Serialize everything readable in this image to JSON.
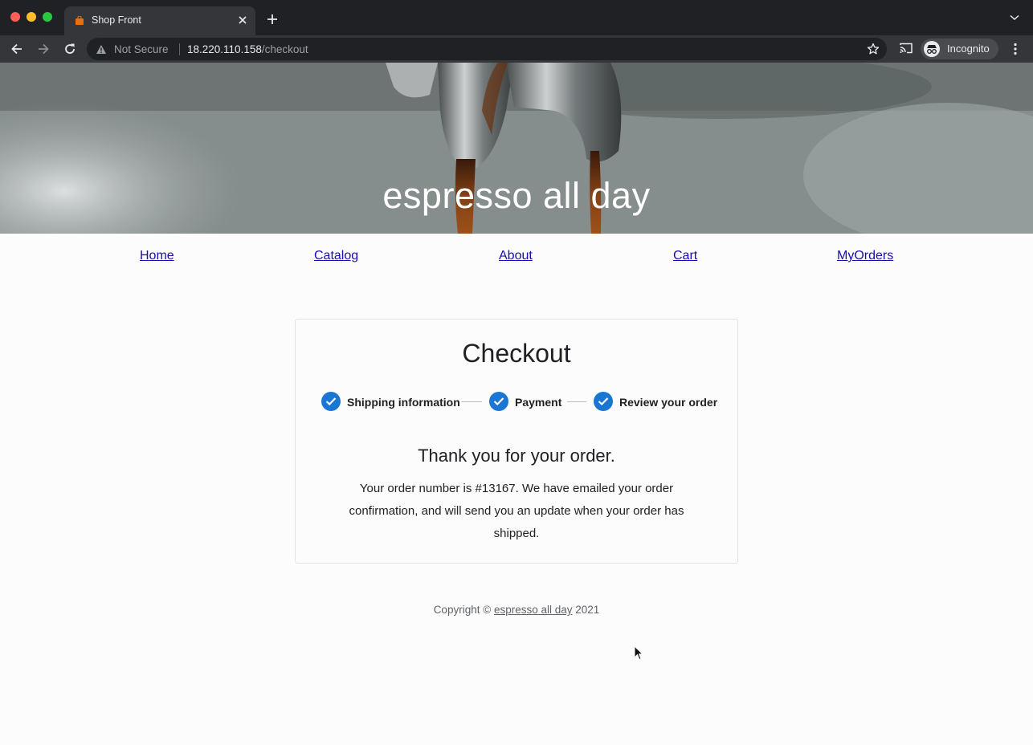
{
  "browser": {
    "tab_title": "Shop Front",
    "security_label": "Not Secure",
    "url_host": "18.220.110.158",
    "url_path": "/checkout",
    "profile_label": "Incognito",
    "icons": [
      "back-icon",
      "forward-icon",
      "reload-icon",
      "warning-icon",
      "star-icon",
      "cast-icon",
      "incognito-icon",
      "kebab-menu-icon",
      "close-icon",
      "plus-icon",
      "chevron-down-icon"
    ]
  },
  "hero": {
    "title": "espresso all day"
  },
  "nav": {
    "home": "Home",
    "catalog": "Catalog",
    "about": "About",
    "cart": "Cart",
    "my_orders": "MyOrders"
  },
  "checkout": {
    "title": "Checkout",
    "steps": [
      {
        "label": "Shipping information",
        "completed": true
      },
      {
        "label": "Payment",
        "completed": true
      },
      {
        "label": "Review your order",
        "completed": true
      }
    ],
    "thanks": "Thank you for your order.",
    "confirmation": "Your order number is #13167. We have emailed your order confirmation, and will send you an update when your order has shipped."
  },
  "footer": {
    "prefix": "Copyright ©",
    "link": "espresso all day",
    "year": "2021"
  },
  "colors": {
    "accent": "#1976d2",
    "link": "#1a0dab",
    "chrome_dark": "#202124",
    "chrome_tab": "#35363a"
  }
}
